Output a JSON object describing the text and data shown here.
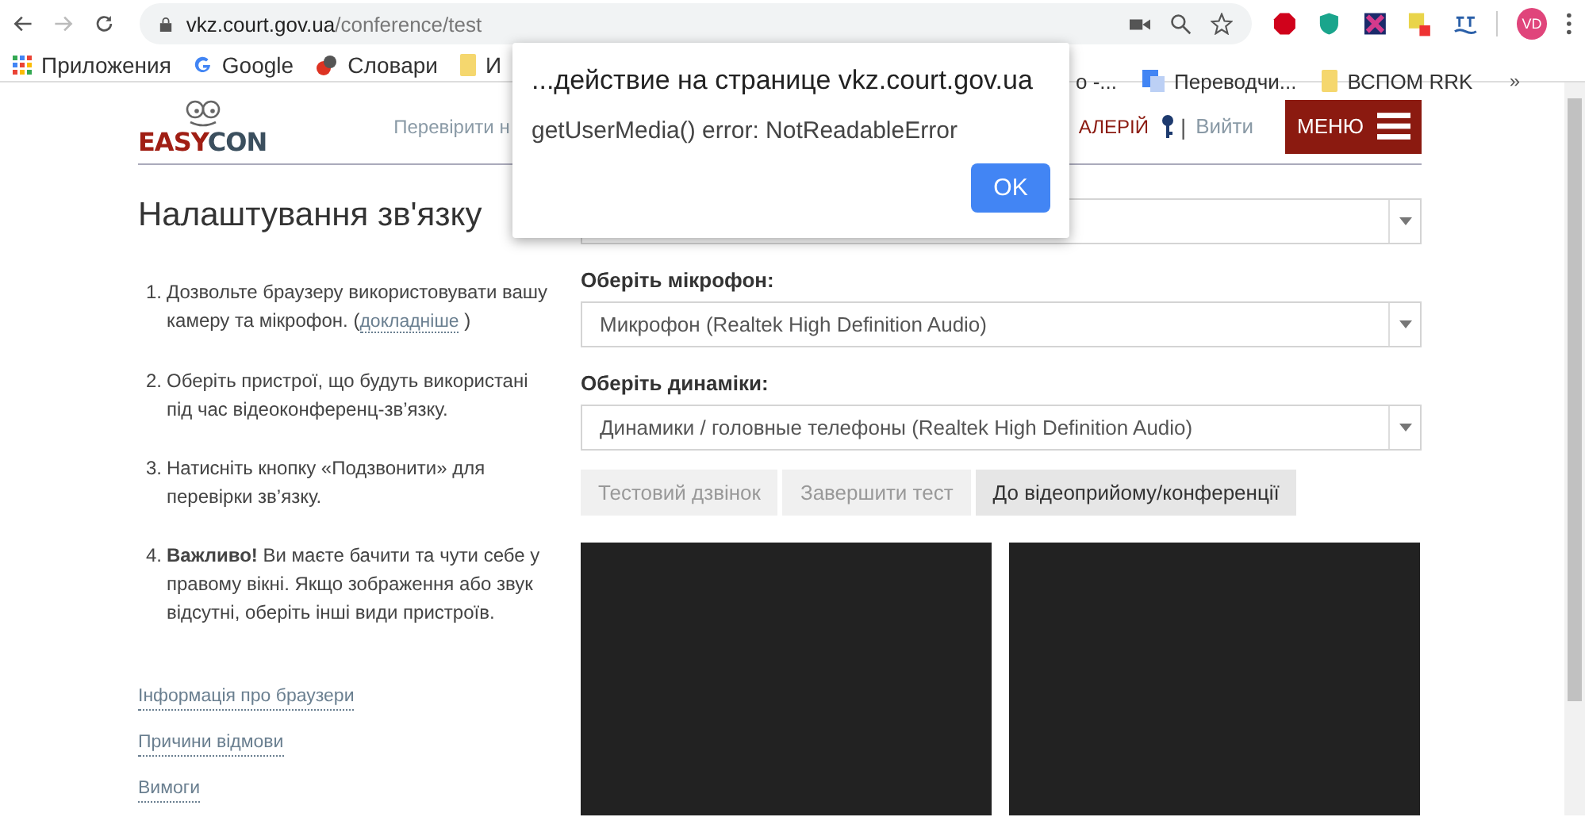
{
  "browser": {
    "address_host": "vkz.court.gov.ua",
    "address_path": "/conference/test",
    "avatar": "VD",
    "bookmarks": [
      {
        "kind": "apps",
        "label": "Приложения"
      },
      {
        "kind": "google",
        "label": "Google"
      },
      {
        "kind": "dict",
        "label": "Словари"
      },
      {
        "kind": "folder",
        "label": "И"
      }
    ],
    "bookmarks_right": [
      {
        "kind": "none",
        "label": "о -..."
      },
      {
        "kind": "translate",
        "label": "Переводчи..."
      },
      {
        "kind": "folder",
        "label": "ВСПОМ RRK"
      }
    ],
    "more": "»"
  },
  "site": {
    "logo_part1": "EASY",
    "logo_part2": "CON",
    "nav_left": "Перевірити н",
    "nav_right": "АЛЕРІЙ",
    "separator": "|",
    "logout": "Вийти",
    "menu": "МЕНЮ"
  },
  "title": "Налаштування зв'язку",
  "steps": [
    {
      "number": "1.",
      "text": "Дозвольте браузеру використовувати вашу камеру та мікрофон. (",
      "link": "докладніше",
      "after": ")"
    },
    {
      "number": "2.",
      "text": "Оберіть пристрої, що будуть використані під час відеоконференц-зв’язку."
    },
    {
      "number": "3.",
      "text": "Натисніть кнопку «Подзвонити» для перевірки зв’язку."
    },
    {
      "number": "4.",
      "text": "**Важливо!** Ви маєте бачити та чути себе у правому вікні. Якщо зображення або звук відсутні, оберіть інші види пристроїв."
    }
  ],
  "links": [
    "Інформація про браузери",
    "Причини відмови",
    "Вимоги"
  ],
  "selects": [
    {
      "label": "Оберіть мікрофон:",
      "value": "Микрофон (Realtek High Definition Audio)"
    },
    {
      "label": "Оберіть динаміки:",
      "value": "Динамики / головные телефоны (Realtek High Definition Audio)"
    }
  ],
  "buttons": [
    {
      "label": "Тестовий дзвінок",
      "disabled": true
    },
    {
      "label": "Завершити тест",
      "disabled": true
    },
    {
      "label": "До відеоприйому/конференції",
      "disabled": false
    }
  ],
  "dialog": {
    "title": "...действие на странице vkz.court.gov.ua",
    "message": "getUserMedia() error: NotReadableError",
    "button": "OK"
  }
}
